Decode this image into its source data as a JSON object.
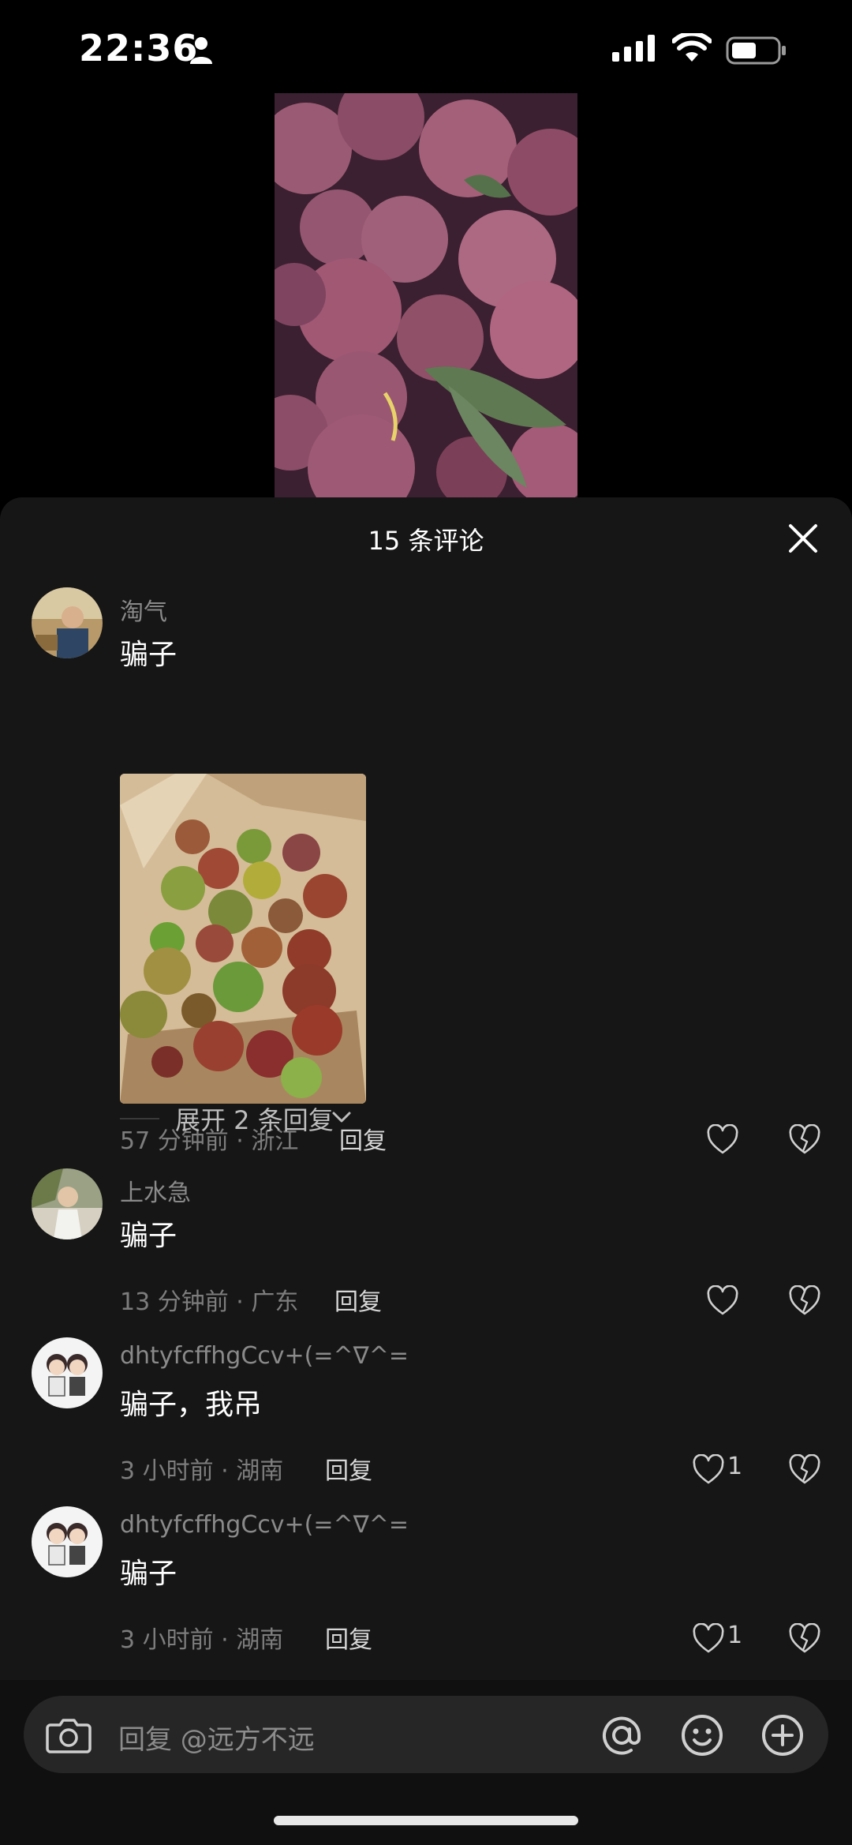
{
  "status_bar": {
    "time": "22:36",
    "icons": [
      "person-icon",
      "signal-icon",
      "wifi-icon",
      "battery-icon"
    ]
  },
  "sheet": {
    "title": "15 条评论"
  },
  "comments": [
    {
      "user": "淘气",
      "text": "骗子",
      "time_location": "57 分钟前 · 浙江",
      "reply": "回复",
      "likes": ""
    },
    {
      "user": "上水急",
      "text": "骗子",
      "time_location": "13 分钟前 · 广东",
      "reply": "回复",
      "likes": ""
    },
    {
      "user": "dhtyfcffhgCcv+(=^∇^=",
      "text": "骗子，我吊",
      "time_location": "3 小时前 · 湖南",
      "reply": "回复",
      "likes": "1"
    },
    {
      "user": "dhtyfcffhgCcv+(=^∇^=",
      "text": "骗子",
      "time_location": "3 小时前 · 湖南",
      "reply": "回复",
      "likes": "1"
    }
  ],
  "expand_replies": "展开 2 条回复",
  "reply_bar": {
    "placeholder": "回复 @远方不远"
  },
  "colors": {
    "sheet_bg": "#161616",
    "text_secondary": "#8a8a8a"
  }
}
